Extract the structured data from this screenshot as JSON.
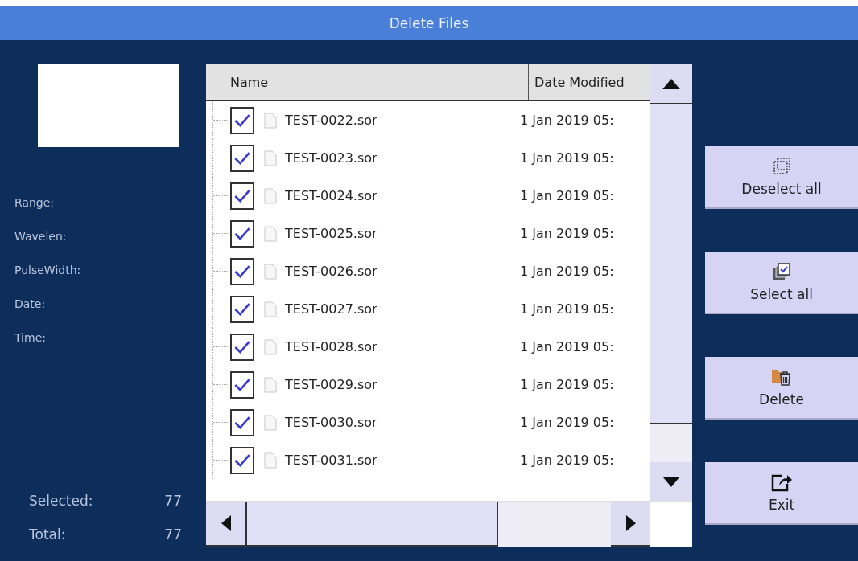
{
  "window": {
    "title": "Delete Files"
  },
  "info": {
    "labels": [
      "Range:",
      "Wavelen:",
      "PulseWidth:",
      "Date:",
      "Time:"
    ]
  },
  "counts": [
    {
      "label": "Selected:",
      "value": "77"
    },
    {
      "label": "Total:",
      "value": "77"
    }
  ],
  "table": {
    "columns": [
      "Name",
      "Date Modified"
    ],
    "rows": [
      {
        "name": "TEST-0022.sor",
        "date": "1 Jan 2019 05:",
        "checked": true
      },
      {
        "name": "TEST-0023.sor",
        "date": "1 Jan 2019 05:",
        "checked": true
      },
      {
        "name": "TEST-0024.sor",
        "date": "1 Jan 2019 05:",
        "checked": true
      },
      {
        "name": "TEST-0025.sor",
        "date": "1 Jan 2019 05:",
        "checked": true
      },
      {
        "name": "TEST-0026.sor",
        "date": "1 Jan 2019 05:",
        "checked": true
      },
      {
        "name": "TEST-0027.sor",
        "date": "1 Jan 2019 05:",
        "checked": true
      },
      {
        "name": "TEST-0028.sor",
        "date": "1 Jan 2019 05:",
        "checked": true
      },
      {
        "name": "TEST-0029.sor",
        "date": "1 Jan 2019 05:",
        "checked": true
      },
      {
        "name": "TEST-0030.sor",
        "date": "1 Jan 2019 05:",
        "checked": true
      },
      {
        "name": "TEST-0031.sor",
        "date": "1 Jan 2019 05:",
        "checked": true
      }
    ]
  },
  "buttons": [
    {
      "kind": "deselect",
      "label": "Deselect all"
    },
    {
      "kind": "select",
      "label": "Select all"
    },
    {
      "kind": "delete",
      "label": "Delete"
    },
    {
      "kind": "exit",
      "label": "Exit"
    }
  ]
}
